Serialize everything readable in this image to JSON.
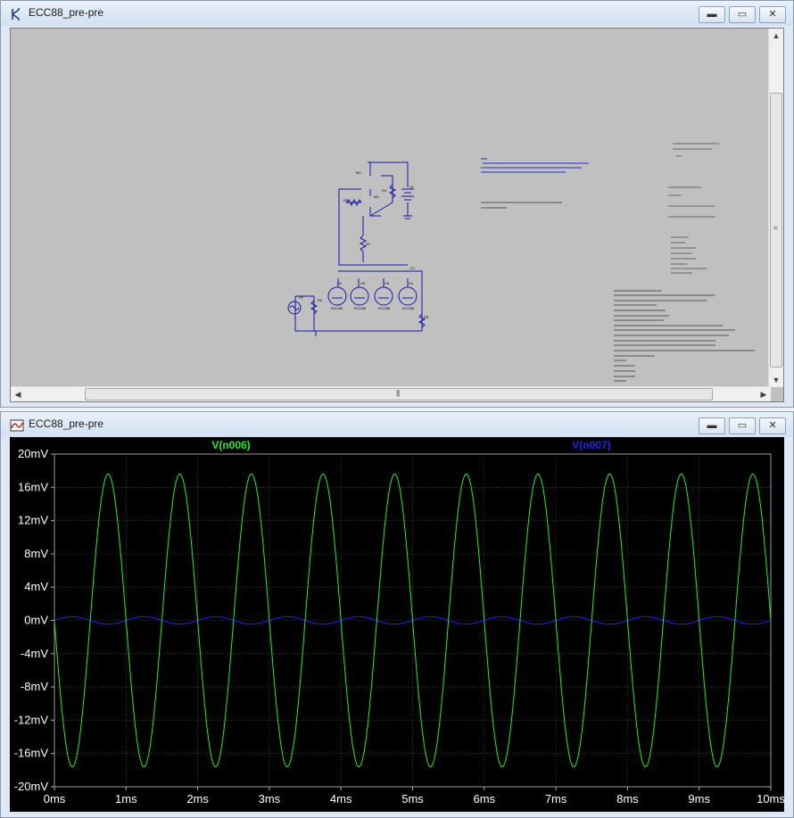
{
  "schematic_window": {
    "title": "ECC88_pre-pre",
    "labels": {
      "u_m2": "M2",
      "u_m3": "M3",
      "u_r3": "R3",
      "u_r4": "R4",
      "u_v1": "V1",
      "u_r1": "R1",
      "u_c1": "C1",
      "u_v2": "V2",
      "u_r2": "R2",
      "u_r5": "R5",
      "u_u1": "U1",
      "u_u2": "U2",
      "u_u3": "U3",
      "u_u4": "U4",
      "tube": "ECC88"
    }
  },
  "plot_window": {
    "title": "ECC88_pre-pre",
    "traces": [
      {
        "name": "V(n006)",
        "color": "#22ee22"
      },
      {
        "name": "V(n007)",
        "color": "#2222ee"
      }
    ]
  },
  "chart_data": {
    "type": "line",
    "title": "",
    "xlabel": "",
    "ylabel": "",
    "xlim": [
      0,
      10
    ],
    "ylim": [
      -20,
      20
    ],
    "x_ticks": [
      "0ms",
      "1ms",
      "2ms",
      "3ms",
      "4ms",
      "5ms",
      "6ms",
      "7ms",
      "8ms",
      "9ms",
      "10ms"
    ],
    "y_ticks": [
      "20mV",
      "16mV",
      "12mV",
      "8mV",
      "4mV",
      "0mV",
      "-4mV",
      "-8mV",
      "-12mV",
      "-16mV",
      "-20mV"
    ],
    "grid": true,
    "series": [
      {
        "name": "V(n006)",
        "type": "sine",
        "amplitude": 17.6,
        "period": 1.0,
        "phase": 0.5,
        "color": "#22ee22",
        "unit": "mV"
      },
      {
        "name": "V(n007)",
        "type": "sine",
        "amplitude": 0.45,
        "period": 1.0,
        "phase": 0.0,
        "color": "#2222ee",
        "unit": "mV"
      }
    ]
  }
}
